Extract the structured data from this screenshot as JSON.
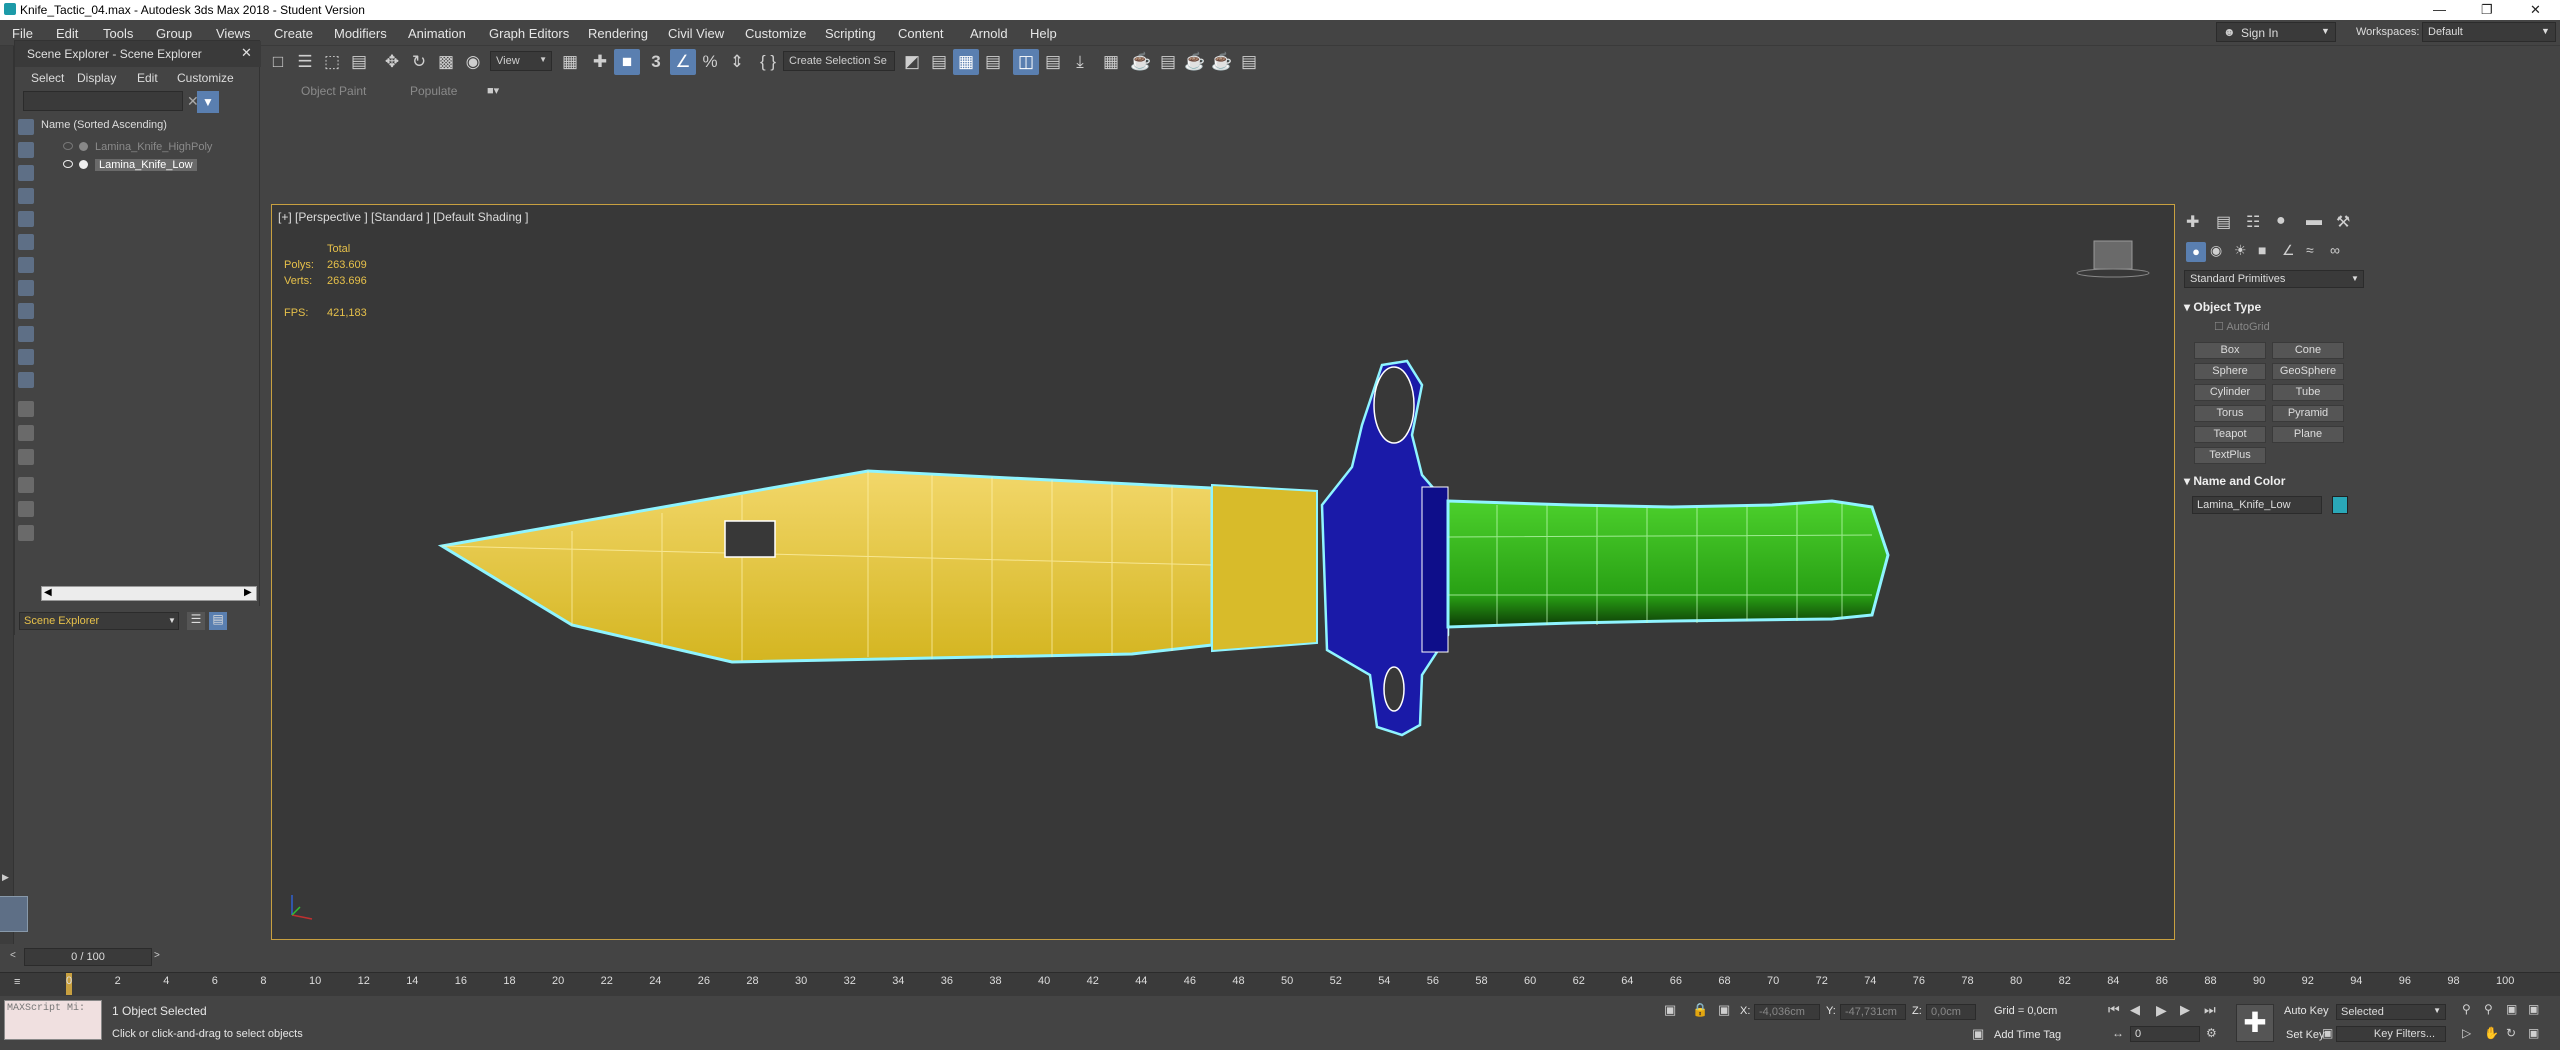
{
  "window": {
    "title": "Knife_Tactic_04.max - Autodesk 3ds Max 2018 - Student Version"
  },
  "menu": [
    "File",
    "Edit",
    "Tools",
    "Group",
    "Views",
    "Create",
    "Modifiers",
    "Animation",
    "Graph Editors",
    "Rendering",
    "Civil View",
    "Customize",
    "Scripting",
    "Content",
    "Arnold",
    "Help"
  ],
  "account": {
    "sign_in": "Sign In",
    "workspaces_label": "Workspaces:",
    "workspace": "Default"
  },
  "toolbar": {
    "view_select": "View",
    "selection_set": "Create Selection Se"
  },
  "ribbon": {
    "tab1": "Object Paint",
    "tab2": "Populate"
  },
  "scene_explorer": {
    "title": "Scene Explorer - Scene Explorer",
    "menu": [
      "Select",
      "Display",
      "Edit",
      "Customize"
    ],
    "column": "Name (Sorted Ascending)",
    "items": [
      {
        "name": "Lamina_Knife_HighPoly"
      },
      {
        "name": "Lamina_Knife_Low"
      }
    ],
    "footer": "Scene Explorer"
  },
  "viewport": {
    "label": "[+] [Perspective ] [Standard ] [Default Shading ]",
    "stats": {
      "total": "Total",
      "polys_label": "Polys:",
      "polys": "263.609",
      "verts_label": "Verts:",
      "verts": "263.696",
      "fps_label": "FPS:",
      "fps": "421,183"
    }
  },
  "command_panel": {
    "category": "Standard Primitives",
    "object_type": "Object Type",
    "autogrid": "AutoGrid",
    "buttons": [
      "Box",
      "Cone",
      "Sphere",
      "GeoSphere",
      "Cylinder",
      "Tube",
      "Torus",
      "Pyramid",
      "Teapot",
      "Plane",
      "TextPlus"
    ],
    "name_color": "Name and Color",
    "object_name": "Lamina_Knife_Low",
    "object_color": "#2aa8b8"
  },
  "timeline": {
    "frame": "0 / 100",
    "ticks": [
      "0",
      "2",
      "4",
      "6",
      "8",
      "10",
      "12",
      "14",
      "16",
      "18",
      "20",
      "22",
      "24",
      "26",
      "28",
      "30",
      "32",
      "34",
      "36",
      "38",
      "40",
      "42",
      "44",
      "46",
      "48",
      "50",
      "52",
      "54",
      "56",
      "58",
      "60",
      "62",
      "64",
      "66",
      "68",
      "70",
      "72",
      "74",
      "76",
      "78",
      "80",
      "82",
      "84",
      "86",
      "88",
      "90",
      "92",
      "94",
      "96",
      "98",
      "100"
    ]
  },
  "status": {
    "maxscript": "MAXScript Mi:",
    "selected": "1 Object Selected",
    "prompt": "Click or click-and-drag to select objects",
    "x_label": "X:",
    "x": "-4,036cm",
    "y_label": "Y:",
    "y": "-47,731cm",
    "z_label": "Z:",
    "z": "0,0cm",
    "grid": "Grid = 0,0cm",
    "add_time_tag": "Add Time Tag",
    "auto_key": "Auto Key",
    "selected_mode": "Selected",
    "set_key": "Set Key",
    "key_filters": "Key Filters...",
    "frame_field": "0"
  }
}
